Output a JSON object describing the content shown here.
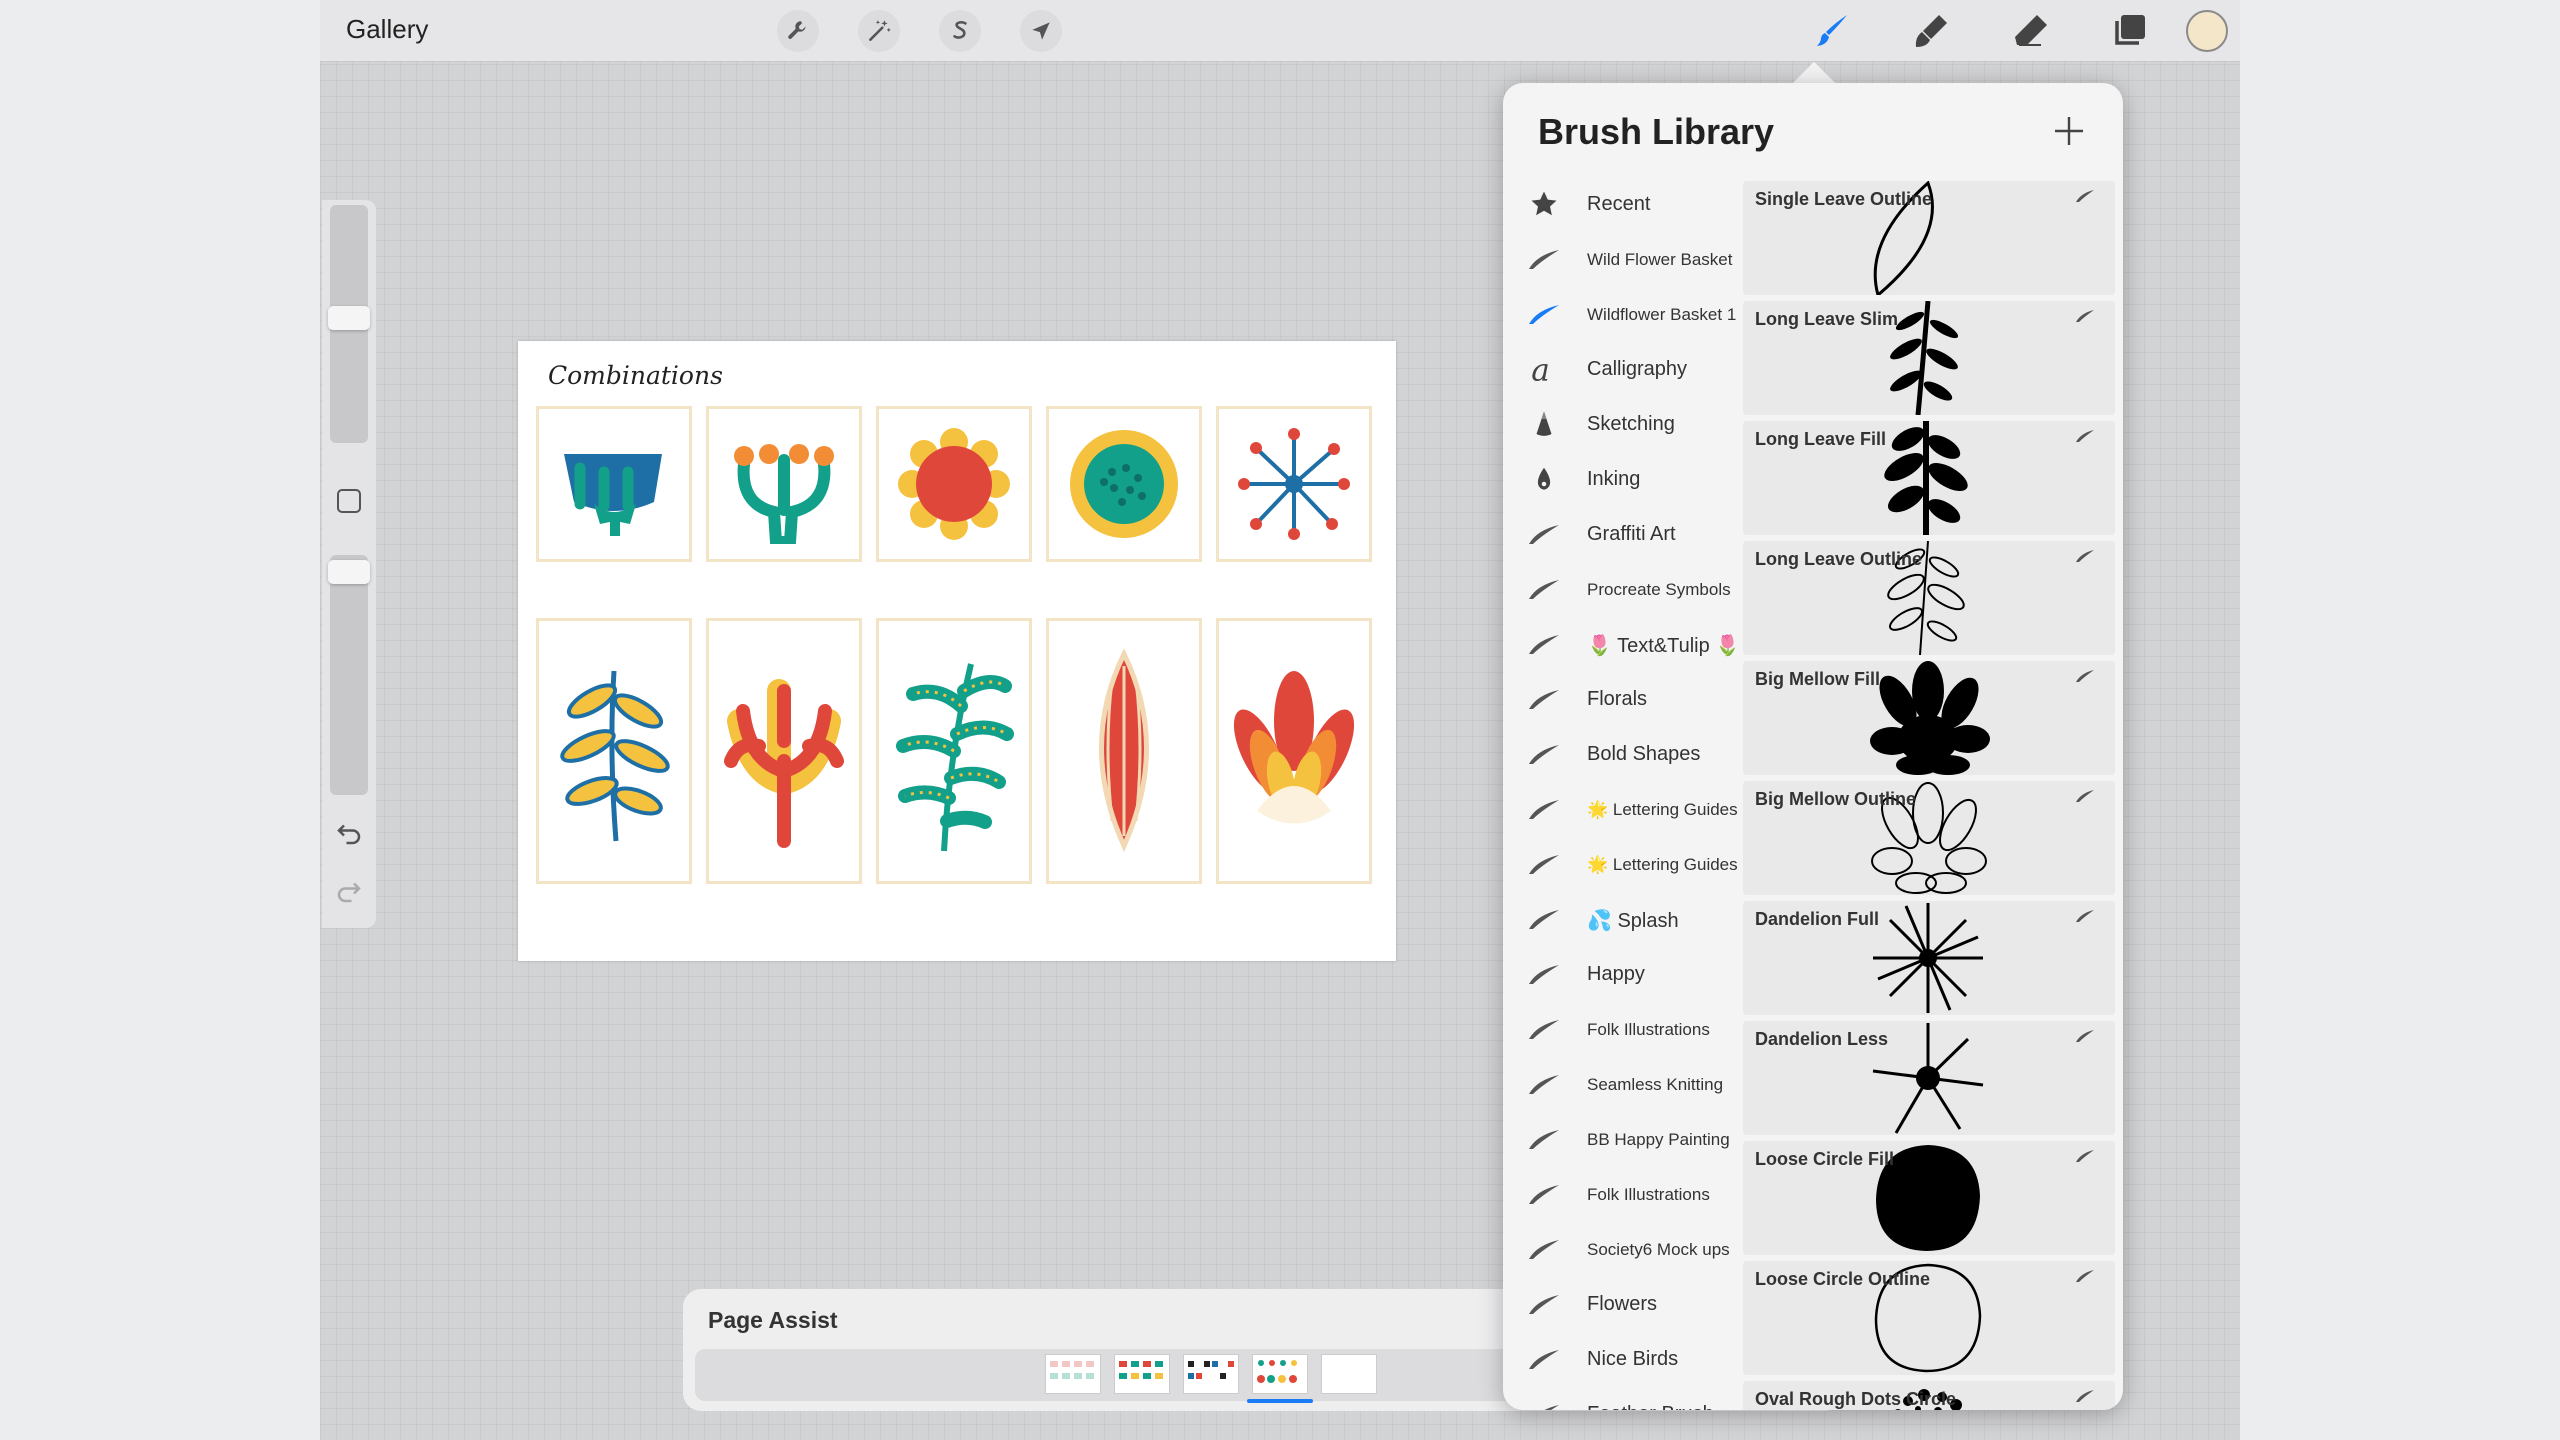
{
  "topbar": {
    "gallery": "Gallery"
  },
  "canvas": {
    "title": "Combinations"
  },
  "page_assist": {
    "title": "Page Assist",
    "selected_page": 4
  },
  "brush_library": {
    "title": "Brush Library",
    "categories": [
      {
        "label": "Recent",
        "icon": "star-icon"
      },
      {
        "label": "Wild Flower Basket",
        "icon": "brush-stroke-icon"
      },
      {
        "label": "Wildflower Basket 1",
        "icon": "brush-stroke-icon",
        "selected": true
      },
      {
        "label": "Calligraphy",
        "icon": "calligraphy-icon"
      },
      {
        "label": "Sketching",
        "icon": "pencil-tip-icon"
      },
      {
        "label": "Inking",
        "icon": "ink-drop-icon"
      },
      {
        "label": "Graffiti Art",
        "icon": "brush-stroke-icon"
      },
      {
        "label": "Procreate Symbols",
        "icon": "brush-stroke-icon"
      },
      {
        "label": "🌷 Text&Tulip 🌷",
        "icon": "brush-stroke-icon"
      },
      {
        "label": "Florals",
        "icon": "brush-stroke-icon"
      },
      {
        "label": "Bold Shapes",
        "icon": "brush-stroke-icon"
      },
      {
        "label": "🌟 Lettering Guides",
        "icon": "brush-stroke-icon"
      },
      {
        "label": "🌟 Lettering Guides",
        "icon": "brush-stroke-icon"
      },
      {
        "label": "💦 Splash",
        "icon": "brush-stroke-icon"
      },
      {
        "label": "Happy",
        "icon": "brush-stroke-icon"
      },
      {
        "label": "Folk Illustrations",
        "icon": "brush-stroke-icon"
      },
      {
        "label": "Seamless Knitting",
        "icon": "brush-stroke-icon"
      },
      {
        "label": "BB Happy Painting",
        "icon": "brush-stroke-icon"
      },
      {
        "label": "Folk Illustrations",
        "icon": "brush-stroke-icon"
      },
      {
        "label": "Society6 Mock ups",
        "icon": "brush-stroke-icon"
      },
      {
        "label": "Flowers",
        "icon": "brush-stroke-icon"
      },
      {
        "label": "Nice Birds",
        "icon": "brush-stroke-icon"
      },
      {
        "label": "Feather Brush",
        "icon": "brush-stroke-icon"
      }
    ],
    "brushes": [
      {
        "label": "Single Leave Outline",
        "preview": "single-leaf-outline"
      },
      {
        "label": "Long Leave Slim",
        "preview": "long-leaf-slim"
      },
      {
        "label": "Long Leave Fill",
        "preview": "long-leaf-fill"
      },
      {
        "label": "Long Leave Outline",
        "preview": "long-leaf-outline"
      },
      {
        "label": "Big Mellow Fill",
        "preview": "big-mellow-fill"
      },
      {
        "label": "Big Mellow Outline",
        "preview": "big-mellow-outline"
      },
      {
        "label": "Dandelion Full",
        "preview": "dandelion-full"
      },
      {
        "label": "Dandelion Less",
        "preview": "dandelion-less"
      },
      {
        "label": "Loose Circle Fill",
        "preview": "loose-circle-fill"
      },
      {
        "label": "Loose Circle Outline",
        "preview": "loose-circle-outline"
      },
      {
        "label": "Oval Rough Dots Circle",
        "preview": "oval-dots"
      }
    ]
  },
  "colors": {
    "accent": "#1a7cf5",
    "current_color": "#f3e6c9",
    "canvas_bg": "#d2d3d5"
  }
}
